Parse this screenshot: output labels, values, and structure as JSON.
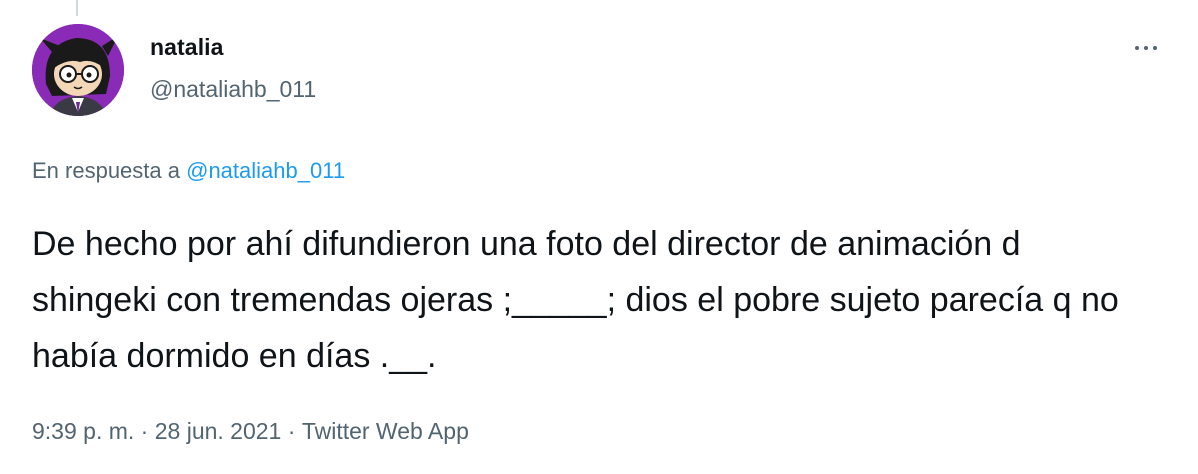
{
  "tweet": {
    "display_name": "natalia",
    "handle": "@nataliahb_011",
    "reply_prefix": "En respuesta a",
    "reply_to": "@nataliahb_011",
    "text": "De hecho por ahí difundieron una foto del director de animación d shingeki con tremendas ojeras ;_____; dios el pobre sujeto parecía q no había dormido en días .__.",
    "time": "9:39 p. m.",
    "separator": " · ",
    "date": "28 jun. 2021",
    "source": "Twitter Web App"
  },
  "icons": {
    "more": "more-horizontal-icon",
    "avatar": "avatar-illustration"
  },
  "colors": {
    "text_primary": "#0f1419",
    "text_secondary": "#536471",
    "accent": "#1d9bf0",
    "avatar_bg": "#8a2bb8"
  }
}
